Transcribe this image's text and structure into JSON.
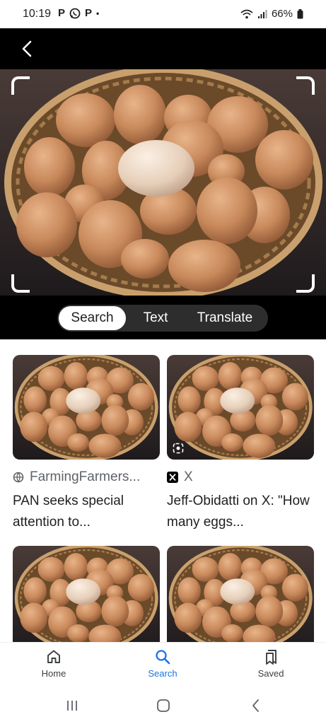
{
  "status_bar": {
    "time": "10:19",
    "left_icons": [
      "P",
      "whatsapp-icon",
      "P",
      "•"
    ],
    "battery": "66%"
  },
  "lens": {
    "modes": [
      {
        "label": "Search",
        "selected": true
      },
      {
        "label": "Text",
        "selected": false
      },
      {
        "label": "Translate",
        "selected": false
      }
    ]
  },
  "results": [
    {
      "source": "FarmingFarmers...",
      "source_icon": "globe-icon",
      "title": "PAN seeks special attention to..."
    },
    {
      "source": "X",
      "source_icon": "x-logo-icon",
      "title": "Jeff-Obidatti on X: \"How many eggs..."
    },
    {
      "source": "",
      "source_icon": "",
      "title": ""
    },
    {
      "source": "",
      "source_icon": "",
      "title": ""
    }
  ],
  "bottom_nav": {
    "items": [
      {
        "label": "Home",
        "icon": "home-icon"
      },
      {
        "label": "Search",
        "icon": "search-icon",
        "active": true
      },
      {
        "label": "Saved",
        "icon": "saved-icon"
      }
    ]
  },
  "colors": {
    "accent": "#1a73e8",
    "egg": "#c98a5c",
    "basket": "#b58a57",
    "background_dark": "#000000"
  }
}
